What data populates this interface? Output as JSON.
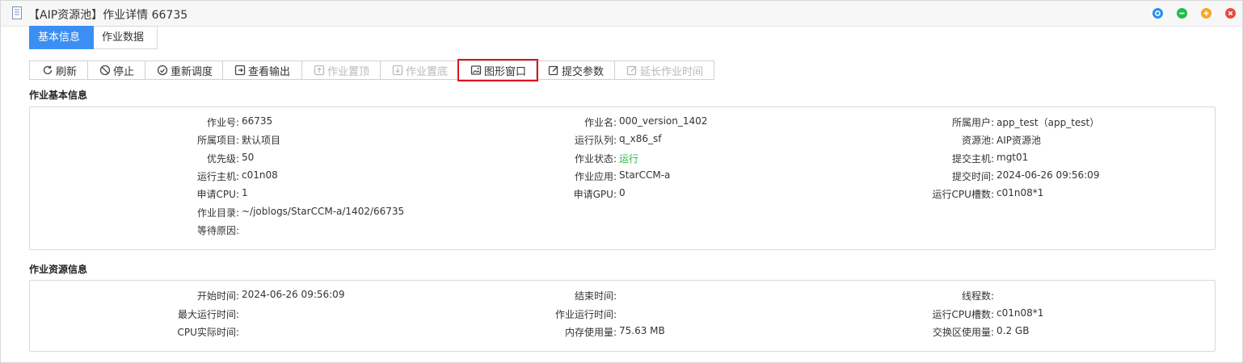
{
  "window": {
    "title": "【AIP资源池】作业详情 66735",
    "controls": {
      "restore_color": "#2b8ff0",
      "minimize_color": "#1fbf4a",
      "maximize_color": "#f5a623",
      "close_color": "#e94b3c"
    }
  },
  "tabs": [
    {
      "label": "基本信息",
      "active": true
    },
    {
      "label": "作业数据",
      "active": false
    }
  ],
  "toolbar": {
    "refresh": "刷新",
    "stop": "停止",
    "reschedule": "重新调度",
    "view_output": "查看输出",
    "job_top": "作业置顶",
    "job_bottom": "作业置底",
    "graphic_window": "图形窗口",
    "submit_params": "提交参数",
    "extend_time": "延长作业时间"
  },
  "basic_info": {
    "title": "作业基本信息",
    "col1": [
      {
        "label": "作业号:",
        "value": "66735"
      },
      {
        "label": "所属项目:",
        "value": "默认项目"
      },
      {
        "label": "优先级:",
        "value": "50"
      },
      {
        "label": "运行主机:",
        "value": "c01n08"
      },
      {
        "label": "申请CPU:",
        "value": "1"
      },
      {
        "label": "作业目录:",
        "value": "~/joblogs/StarCCM-a/1402/66735"
      },
      {
        "label": "等待原因:",
        "value": ""
      }
    ],
    "col2": [
      {
        "label": "作业名:",
        "value": "000_version_1402"
      },
      {
        "label": "运行队列:",
        "value": "q_x86_sf"
      },
      {
        "label": "作业状态:",
        "value": "运行"
      },
      {
        "label": "作业应用:",
        "value": "StarCCM-a"
      },
      {
        "label": "申请GPU:",
        "value": "0"
      }
    ],
    "col3": [
      {
        "label": "所属用户:",
        "value": "app_test（app_test）"
      },
      {
        "label": "资源池:",
        "value": "AIP资源池"
      },
      {
        "label": "提交主机:",
        "value": "mgt01"
      },
      {
        "label": "提交时间:",
        "value": "2024-06-26 09:56:09"
      },
      {
        "label": "运行CPU槽数:",
        "value": "c01n08*1"
      }
    ]
  },
  "resource_info": {
    "title": "作业资源信息",
    "col1": [
      {
        "label": "开始时间:",
        "value": "2024-06-26 09:56:09"
      },
      {
        "label": "最大运行时间:",
        "value": ""
      },
      {
        "label": "CPU实际时间:",
        "value": ""
      }
    ],
    "col2": [
      {
        "label": "结束时间:",
        "value": ""
      },
      {
        "label": "作业运行时间:",
        "value": ""
      },
      {
        "label": "内存使用量:",
        "value": "75.63 MB"
      }
    ],
    "col3": [
      {
        "label": "线程数:",
        "value": ""
      },
      {
        "label": "运行CPU槽数:",
        "value": "c01n08*1"
      },
      {
        "label": "交换区使用量:",
        "value": "0.2 GB"
      }
    ]
  },
  "colors": {
    "accent": "#3b8ff3",
    "status_running": "#2db64a",
    "highlight_box": "#e0141e"
  }
}
